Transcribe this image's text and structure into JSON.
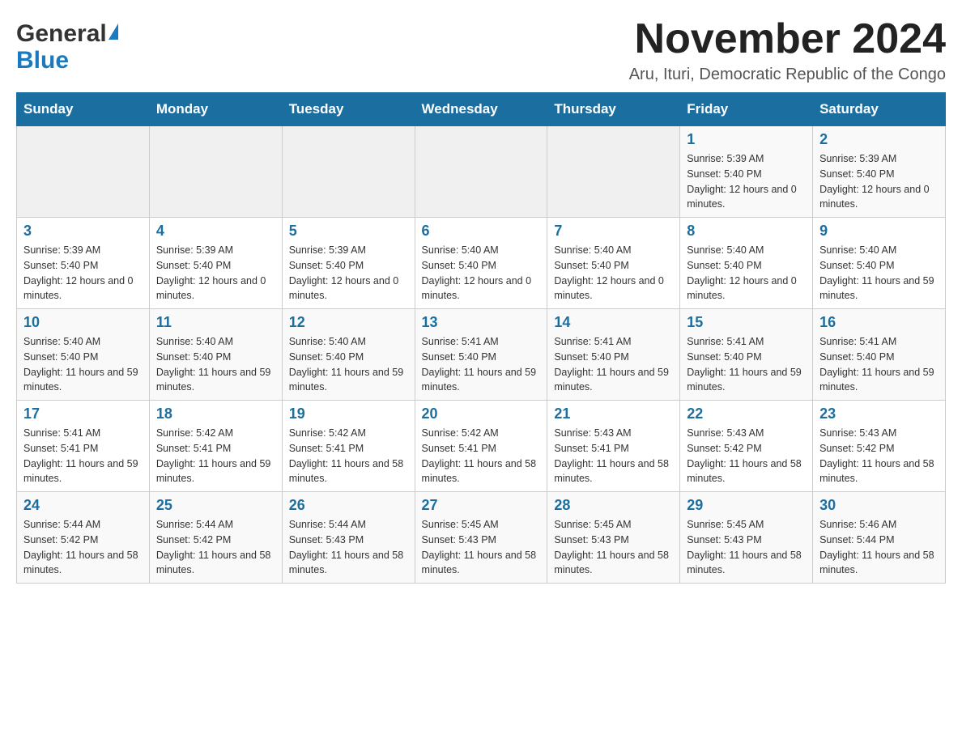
{
  "header": {
    "logo_general": "General",
    "logo_blue": "Blue",
    "month_year": "November 2024",
    "location": "Aru, Ituri, Democratic Republic of the Congo"
  },
  "calendar": {
    "days_of_week": [
      "Sunday",
      "Monday",
      "Tuesday",
      "Wednesday",
      "Thursday",
      "Friday",
      "Saturday"
    ],
    "weeks": [
      [
        {
          "day": "",
          "info": ""
        },
        {
          "day": "",
          "info": ""
        },
        {
          "day": "",
          "info": ""
        },
        {
          "day": "",
          "info": ""
        },
        {
          "day": "",
          "info": ""
        },
        {
          "day": "1",
          "info": "Sunrise: 5:39 AM\nSunset: 5:40 PM\nDaylight: 12 hours and 0 minutes."
        },
        {
          "day": "2",
          "info": "Sunrise: 5:39 AM\nSunset: 5:40 PM\nDaylight: 12 hours and 0 minutes."
        }
      ],
      [
        {
          "day": "3",
          "info": "Sunrise: 5:39 AM\nSunset: 5:40 PM\nDaylight: 12 hours and 0 minutes."
        },
        {
          "day": "4",
          "info": "Sunrise: 5:39 AM\nSunset: 5:40 PM\nDaylight: 12 hours and 0 minutes."
        },
        {
          "day": "5",
          "info": "Sunrise: 5:39 AM\nSunset: 5:40 PM\nDaylight: 12 hours and 0 minutes."
        },
        {
          "day": "6",
          "info": "Sunrise: 5:40 AM\nSunset: 5:40 PM\nDaylight: 12 hours and 0 minutes."
        },
        {
          "day": "7",
          "info": "Sunrise: 5:40 AM\nSunset: 5:40 PM\nDaylight: 12 hours and 0 minutes."
        },
        {
          "day": "8",
          "info": "Sunrise: 5:40 AM\nSunset: 5:40 PM\nDaylight: 12 hours and 0 minutes."
        },
        {
          "day": "9",
          "info": "Sunrise: 5:40 AM\nSunset: 5:40 PM\nDaylight: 11 hours and 59 minutes."
        }
      ],
      [
        {
          "day": "10",
          "info": "Sunrise: 5:40 AM\nSunset: 5:40 PM\nDaylight: 11 hours and 59 minutes."
        },
        {
          "day": "11",
          "info": "Sunrise: 5:40 AM\nSunset: 5:40 PM\nDaylight: 11 hours and 59 minutes."
        },
        {
          "day": "12",
          "info": "Sunrise: 5:40 AM\nSunset: 5:40 PM\nDaylight: 11 hours and 59 minutes."
        },
        {
          "day": "13",
          "info": "Sunrise: 5:41 AM\nSunset: 5:40 PM\nDaylight: 11 hours and 59 minutes."
        },
        {
          "day": "14",
          "info": "Sunrise: 5:41 AM\nSunset: 5:40 PM\nDaylight: 11 hours and 59 minutes."
        },
        {
          "day": "15",
          "info": "Sunrise: 5:41 AM\nSunset: 5:40 PM\nDaylight: 11 hours and 59 minutes."
        },
        {
          "day": "16",
          "info": "Sunrise: 5:41 AM\nSunset: 5:40 PM\nDaylight: 11 hours and 59 minutes."
        }
      ],
      [
        {
          "day": "17",
          "info": "Sunrise: 5:41 AM\nSunset: 5:41 PM\nDaylight: 11 hours and 59 minutes."
        },
        {
          "day": "18",
          "info": "Sunrise: 5:42 AM\nSunset: 5:41 PM\nDaylight: 11 hours and 59 minutes."
        },
        {
          "day": "19",
          "info": "Sunrise: 5:42 AM\nSunset: 5:41 PM\nDaylight: 11 hours and 58 minutes."
        },
        {
          "day": "20",
          "info": "Sunrise: 5:42 AM\nSunset: 5:41 PM\nDaylight: 11 hours and 58 minutes."
        },
        {
          "day": "21",
          "info": "Sunrise: 5:43 AM\nSunset: 5:41 PM\nDaylight: 11 hours and 58 minutes."
        },
        {
          "day": "22",
          "info": "Sunrise: 5:43 AM\nSunset: 5:42 PM\nDaylight: 11 hours and 58 minutes."
        },
        {
          "day": "23",
          "info": "Sunrise: 5:43 AM\nSunset: 5:42 PM\nDaylight: 11 hours and 58 minutes."
        }
      ],
      [
        {
          "day": "24",
          "info": "Sunrise: 5:44 AM\nSunset: 5:42 PM\nDaylight: 11 hours and 58 minutes."
        },
        {
          "day": "25",
          "info": "Sunrise: 5:44 AM\nSunset: 5:42 PM\nDaylight: 11 hours and 58 minutes."
        },
        {
          "day": "26",
          "info": "Sunrise: 5:44 AM\nSunset: 5:43 PM\nDaylight: 11 hours and 58 minutes."
        },
        {
          "day": "27",
          "info": "Sunrise: 5:45 AM\nSunset: 5:43 PM\nDaylight: 11 hours and 58 minutes."
        },
        {
          "day": "28",
          "info": "Sunrise: 5:45 AM\nSunset: 5:43 PM\nDaylight: 11 hours and 58 minutes."
        },
        {
          "day": "29",
          "info": "Sunrise: 5:45 AM\nSunset: 5:43 PM\nDaylight: 11 hours and 58 minutes."
        },
        {
          "day": "30",
          "info": "Sunrise: 5:46 AM\nSunset: 5:44 PM\nDaylight: 11 hours and 58 minutes."
        }
      ]
    ]
  }
}
